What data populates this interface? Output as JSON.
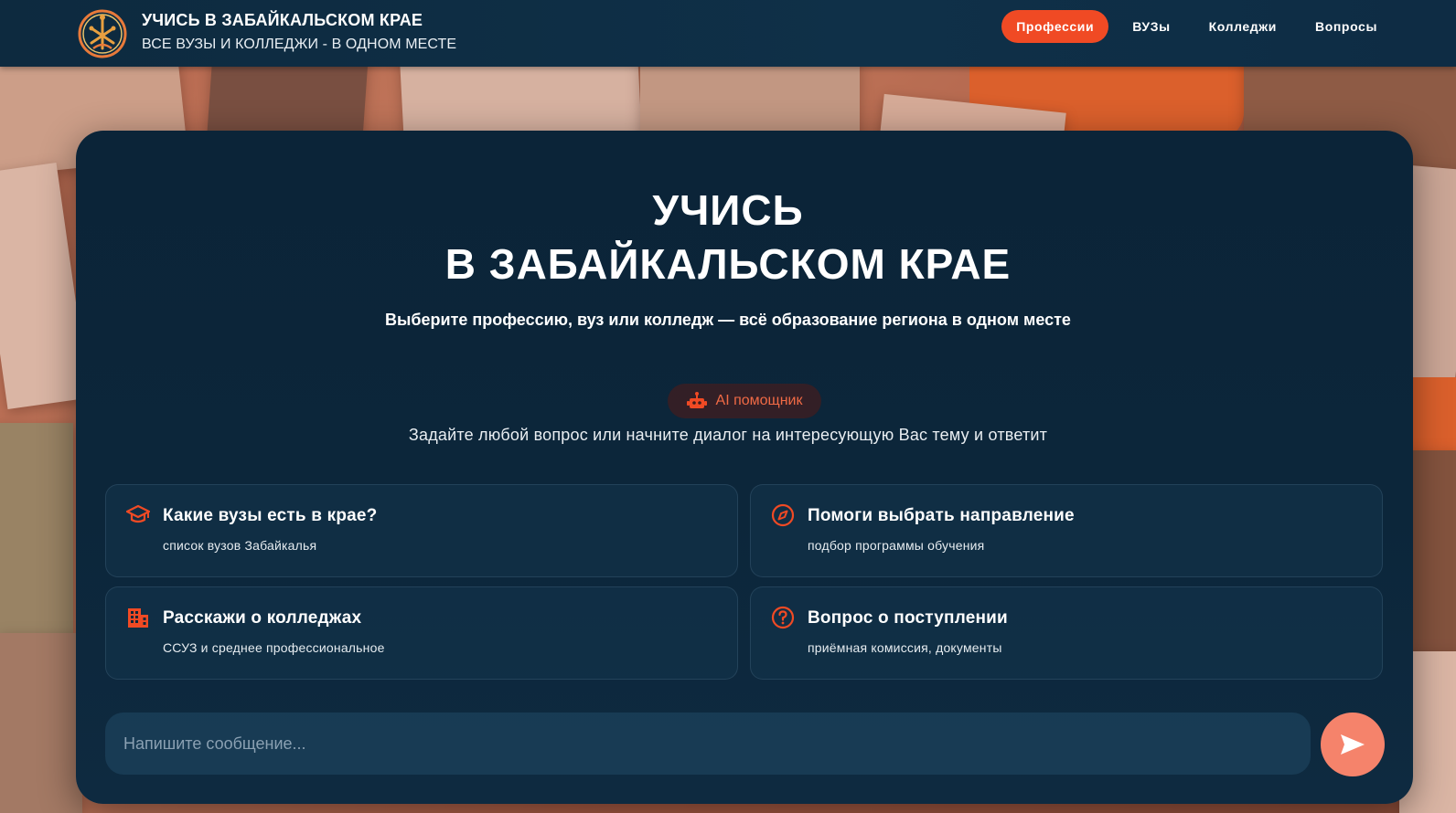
{
  "header": {
    "title": "УЧИСЬ В ЗАБАЙКАЛЬСКОМ КРАЕ",
    "subtitle": "ВСЕ ВУЗЫ И КОЛЛЕДЖИ - В ОДНОМ МЕСТЕ",
    "nav": [
      {
        "label": "Профессии",
        "active": true
      },
      {
        "label": "ВУЗы",
        "active": false
      },
      {
        "label": "Колледжи",
        "active": false
      },
      {
        "label": "Вопросы",
        "active": false
      }
    ]
  },
  "hero": {
    "title_line1": "УЧИСЬ",
    "title_line2": "В ЗАБАЙКАЛЬСКОМ КРАЕ",
    "subtitle": "Выберите профессию, вуз или колледж — всё образование региона в одном месте"
  },
  "assistant": {
    "badge_label": "AI помощник",
    "badge_icon": "robot-icon",
    "description": "Задайте любой вопрос или начните диалог на интересующую Вас тему и ответит"
  },
  "suggestions": [
    {
      "icon": "graduation-cap-icon",
      "title": "Какие вузы есть в крае?",
      "subtitle": "список вузов Забайкалья"
    },
    {
      "icon": "compass-icon",
      "title": "Помоги выбрать направление",
      "subtitle": "подбор программы обучения"
    },
    {
      "icon": "building-icon",
      "title": "Расскажи о колледжах",
      "subtitle": "ССУЗ и среднее профессиональное"
    },
    {
      "icon": "question-circle-icon",
      "title": "Вопрос о поступлении",
      "subtitle": "приёмная комиссия, документы"
    }
  ],
  "chat": {
    "placeholder": "Напишите сообщение...",
    "value": "",
    "send_icon": "send-icon"
  },
  "colors": {
    "accent": "#f04a24",
    "panel": "#0b2438",
    "header": "#0d2a3f",
    "send_button": "#f5836b"
  }
}
